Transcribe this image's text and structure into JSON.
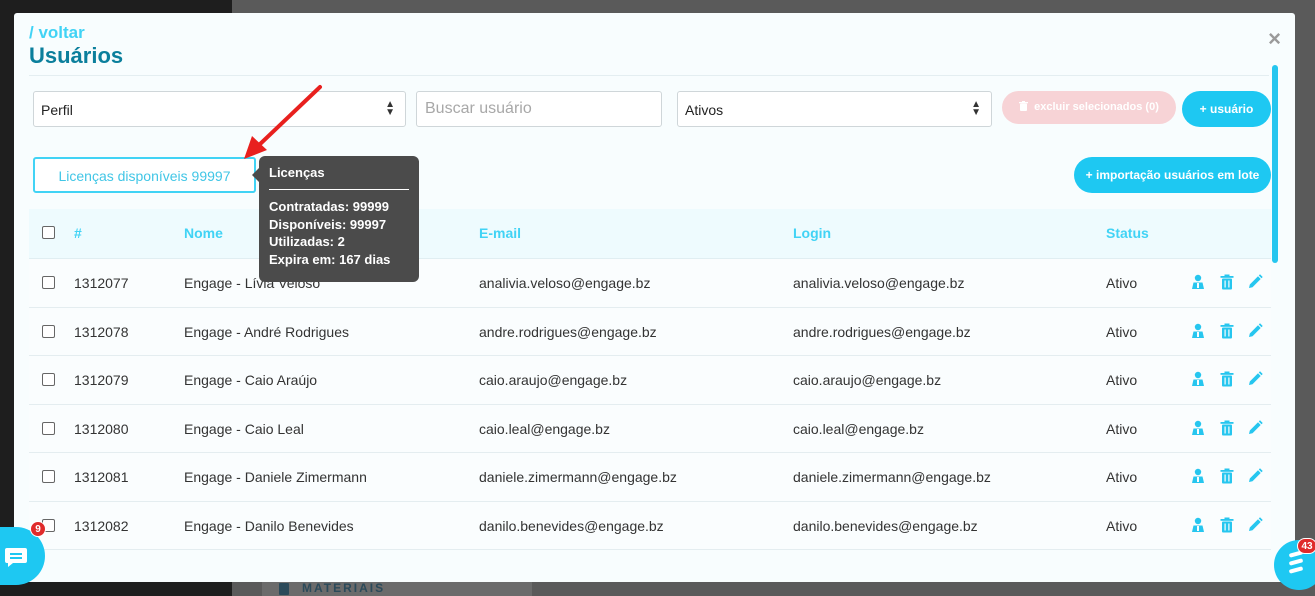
{
  "background": {
    "sidebar_item": "MATERIAIS"
  },
  "modal": {
    "back_link": "/ voltar",
    "title": "Usuários",
    "close": "×"
  },
  "filters": {
    "perfil": "Perfil",
    "search_placeholder": "Buscar usuário",
    "status": "Ativos",
    "delete_selected": "excluir selecionados (0)",
    "add_user": "+ usuário",
    "bulk_import": "+ importação usuários em lote",
    "licenses_button": "Licenças disponíveis 99997"
  },
  "tooltip": {
    "title": "Licenças",
    "lines": [
      "Contratadas: 99999",
      "Disponíveis: 99997",
      "Utilizadas: 2",
      "Expira em: 167 dias"
    ]
  },
  "table": {
    "headers": {
      "id": "#",
      "nome": "Nome",
      "email": "E-mail",
      "login": "Login",
      "status": "Status"
    },
    "rows": [
      {
        "id": "1312077",
        "nome": "Engage - Lívia Veloso",
        "email": "analivia.veloso@engage.bz",
        "login": "analivia.veloso@engage.bz",
        "status": "Ativo"
      },
      {
        "id": "1312078",
        "nome": "Engage - André Rodrigues",
        "email": "andre.rodrigues@engage.bz",
        "login": "andre.rodrigues@engage.bz",
        "status": "Ativo"
      },
      {
        "id": "1312079",
        "nome": "Engage - Caio Araújo",
        "email": "caio.araujo@engage.bz",
        "login": "caio.araujo@engage.bz",
        "status": "Ativo"
      },
      {
        "id": "1312080",
        "nome": "Engage - Caio Leal",
        "email": "caio.leal@engage.bz",
        "login": "caio.leal@engage.bz",
        "status": "Ativo"
      },
      {
        "id": "1312081",
        "nome": "Engage - Daniele Zimermann",
        "email": "daniele.zimermann@engage.bz",
        "login": "daniele.zimermann@engage.bz",
        "status": "Ativo"
      },
      {
        "id": "1312082",
        "nome": "Engage - Danilo Benevides",
        "email": "danilo.benevides@engage.bz",
        "login": "danilo.benevides@engage.bz",
        "status": "Ativo"
      }
    ]
  },
  "widgets": {
    "chat_badge": "9",
    "engage_badge": "43"
  },
  "colors": {
    "accent": "#1ec8f2",
    "title": "#0b7f9c",
    "danger_soft": "#f7d3d6",
    "tooltip_bg": "#4b4b4b",
    "arrow": "#e8201e"
  },
  "icons": {
    "row_actions": [
      "user-icon",
      "trash-icon",
      "pencil-icon"
    ]
  }
}
